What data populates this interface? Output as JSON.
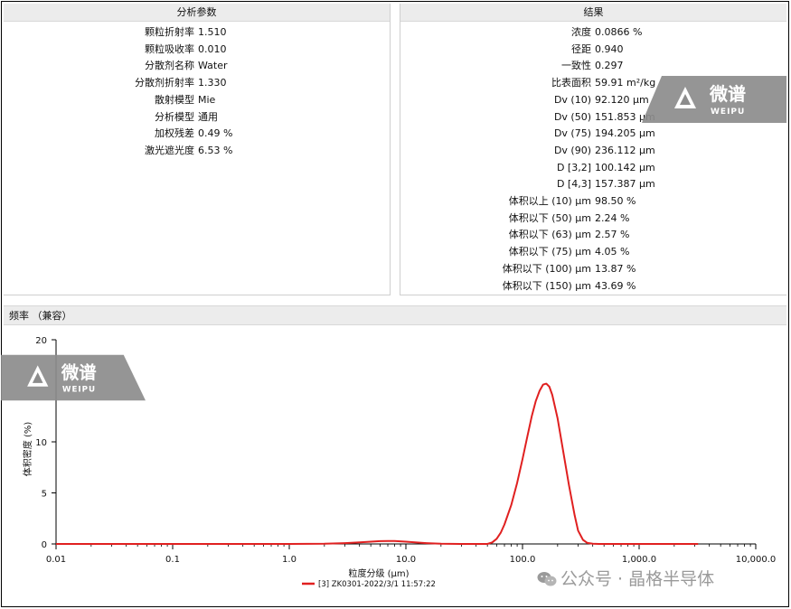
{
  "params_panel": {
    "title": "分析参数",
    "rows": [
      {
        "label": "颗粒折射率",
        "value": "1.510"
      },
      {
        "label": "颗粒吸收率",
        "value": "0.010"
      },
      {
        "label": "分散剂名称",
        "value": "Water"
      },
      {
        "label": "分散剂折射率",
        "value": "1.330"
      },
      {
        "label": "散射模型",
        "value": "Mie"
      },
      {
        "label": "分析模型",
        "value": "通用"
      },
      {
        "label": "加权残差",
        "value": "0.49 %"
      },
      {
        "label": "激光遮光度",
        "value": "6.53 %"
      }
    ]
  },
  "results_panel": {
    "title": "结果",
    "rows": [
      {
        "label": "浓度",
        "value": "0.0866 %"
      },
      {
        "label": "径距",
        "value": "0.940"
      },
      {
        "label": "一致性",
        "value": "0.297"
      },
      {
        "label": "比表面积",
        "value": "59.91 m²/kg"
      },
      {
        "label": "Dv (10)",
        "value": "92.120 μm"
      },
      {
        "label": "Dv (50)",
        "value": "151.853 μm"
      },
      {
        "label": "Dv (75)",
        "value": "194.205 μm"
      },
      {
        "label": "Dv (90)",
        "value": "236.112 μm"
      },
      {
        "label": "D [3,2]",
        "value": "100.142 μm"
      },
      {
        "label": "D [4,3]",
        "value": "157.387 μm"
      },
      {
        "label": "体积以上 (10) μm",
        "value": "98.50 %"
      },
      {
        "label": "体积以下 (50) μm",
        "value": "2.24 %"
      },
      {
        "label": "体积以下 (63) μm",
        "value": "2.57 %"
      },
      {
        "label": "体积以下 (75) μm",
        "value": "4.05 %"
      },
      {
        "label": "体积以下 (100) μm",
        "value": "13.87 %"
      },
      {
        "label": "体积以下 (150) μm",
        "value": "43.69 %"
      }
    ]
  },
  "frequency_section": {
    "title": "频率 （兼容）"
  },
  "watermark": {
    "brand_cn": "微谱",
    "brand_en": "WEIPU",
    "footer": "公众号 · 晶格半导体"
  },
  "colors": {
    "series": "#e02020",
    "panel_header_bg": "#ececec",
    "watermark_bg": "#8c8c8c"
  },
  "chart_data": {
    "type": "line",
    "title": "",
    "xlabel": "粒度分级 (μm)",
    "ylabel": "体积密度 (%)",
    "x_scale": "log",
    "xlim": [
      0.01,
      10000
    ],
    "ylim": [
      0,
      20
    ],
    "x_ticks": [
      0.01,
      0.1,
      1,
      10,
      100,
      1000,
      10000
    ],
    "x_tick_labels": [
      "0.01",
      "0.1",
      "1.0",
      "10.0",
      "100.0",
      "1,000.0",
      "10,000.0"
    ],
    "y_ticks": [
      0,
      5,
      10,
      20
    ],
    "y_tick_labels": [
      "0",
      "5",
      "10",
      "20"
    ],
    "grid": false,
    "legend_position": "bottom-center",
    "series": [
      {
        "name": "[3] ZK0301-2022/3/1 11:57:22",
        "color": "#e02020",
        "x": [
          0.01,
          0.1,
          1,
          2,
          3,
          4,
          5,
          6,
          7,
          8,
          10,
          12,
          15,
          20,
          30,
          40,
          50,
          55,
          60,
          65,
          70,
          80,
          90,
          100,
          110,
          120,
          130,
          140,
          150,
          160,
          170,
          180,
          200,
          220,
          250,
          280,
          300,
          330,
          360,
          400,
          450,
          500,
          1000,
          3200
        ],
        "values": [
          0,
          0,
          0,
          0.02,
          0.08,
          0.15,
          0.22,
          0.27,
          0.29,
          0.28,
          0.22,
          0.15,
          0.08,
          0.02,
          0,
          0,
          0,
          0.15,
          0.5,
          1.1,
          1.9,
          3.8,
          6.0,
          8.3,
          10.5,
          12.5,
          14.0,
          15.0,
          15.6,
          15.7,
          15.4,
          14.6,
          12.3,
          9.5,
          5.8,
          2.8,
          1.3,
          0.4,
          0.1,
          0.02,
          0,
          0,
          0,
          0
        ]
      }
    ]
  }
}
